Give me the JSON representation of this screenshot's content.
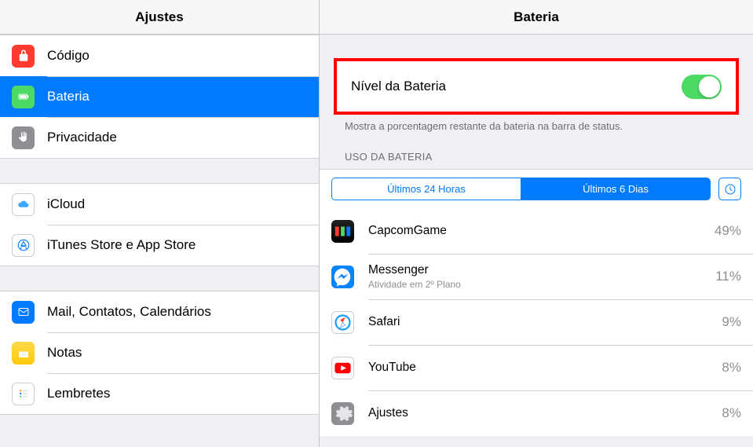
{
  "sidebar": {
    "title": "Ajustes",
    "groups": [
      {
        "items": [
          {
            "label": "Código",
            "icon": "lock",
            "bg": "icon-red"
          },
          {
            "label": "Bateria",
            "icon": "battery",
            "bg": "icon-green",
            "selected": true
          },
          {
            "label": "Privacidade",
            "icon": "hand",
            "bg": "icon-gray"
          }
        ]
      },
      {
        "items": [
          {
            "label": "iCloud",
            "icon": "cloud",
            "bg": "icon-white"
          },
          {
            "label": "iTunes Store e App Store",
            "icon": "appstore",
            "bg": "icon-white"
          }
        ]
      },
      {
        "items": [
          {
            "label": "Mail, Contatos, Calendários",
            "icon": "mail",
            "bg": "icon-blue"
          },
          {
            "label": "Notas",
            "icon": "notes",
            "bg": "icon-notes"
          },
          {
            "label": "Lembretes",
            "icon": "reminders",
            "bg": "icon-white"
          }
        ]
      }
    ]
  },
  "content": {
    "title": "Bateria",
    "level": {
      "label": "Nível da Bateria",
      "on": true
    },
    "desc": "Mostra a porcentagem restante da bateria na barra de status.",
    "usage_heading": "USO DA BATERIA",
    "segments": [
      "Últimos 24 Horas",
      "Últimos 6 Dias"
    ],
    "active_segment": 1,
    "apps": [
      {
        "name": "CapcomGame",
        "pct": "49%",
        "icon": "capcom"
      },
      {
        "name": "Messenger",
        "sub": "Atividade em 2º Plano",
        "pct": "11%",
        "icon": "messenger"
      },
      {
        "name": "Safari",
        "pct": "9%",
        "icon": "safari"
      },
      {
        "name": "YouTube",
        "pct": "8%",
        "icon": "youtube"
      },
      {
        "name": "Ajustes",
        "pct": "8%",
        "icon": "settings"
      }
    ]
  }
}
